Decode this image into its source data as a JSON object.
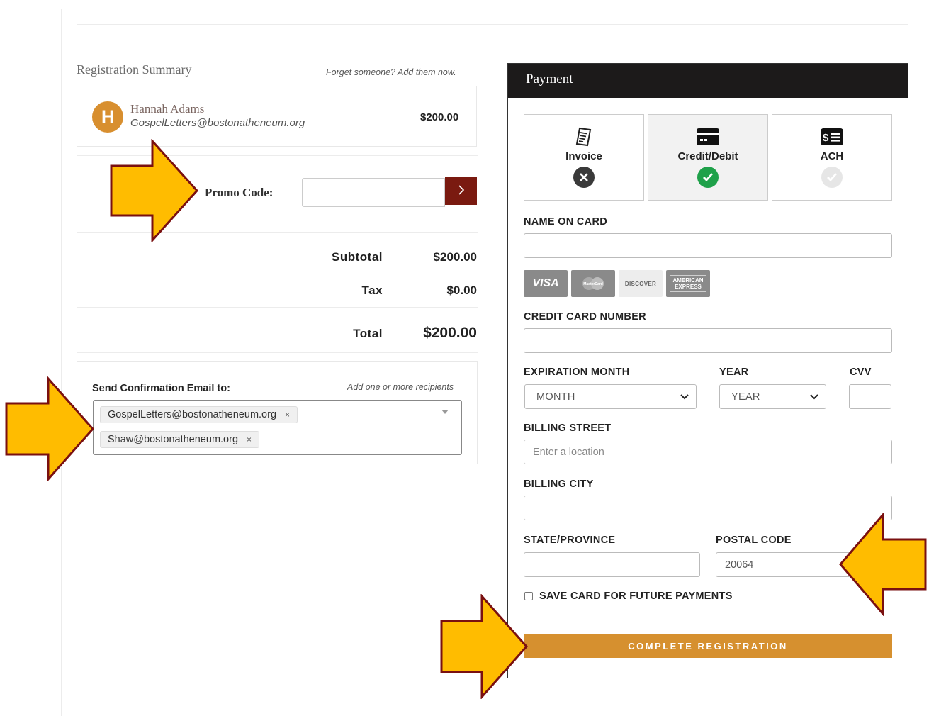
{
  "summary": {
    "title": "Registration Summary",
    "forget_link": "Forget someone? Add them now.",
    "attendee": {
      "initial": "H",
      "name": "Hannah Adams",
      "email": "GospelLetters@bostonatheneum.org",
      "price": "$200.00"
    },
    "promo": {
      "label": "Promo Code:",
      "value": "",
      "submit_icon": "chevron-right-icon"
    },
    "subtotal_label": "Subtotal",
    "subtotal_value": "$200.00",
    "tax_label": "Tax",
    "tax_value": "$0.00",
    "total_label": "Total",
    "total_value": "$200.00"
  },
  "confirmation": {
    "label": "Send Confirmation Email to:",
    "hint": "Add one or more recipients",
    "recipients": [
      "GospelLetters@bostonatheneum.org",
      "Shaw@bostonatheneum.org"
    ],
    "remove_glyph": "×"
  },
  "payment": {
    "title": "Payment",
    "methods": [
      {
        "label": "Invoice",
        "icon": "receipt-icon",
        "state": "unavailable"
      },
      {
        "label": "Credit/Debit",
        "icon": "credit-card-icon",
        "state": "selected"
      },
      {
        "label": "ACH",
        "icon": "bank-transfer-icon",
        "state": "available"
      }
    ],
    "name_label": "NAME ON CARD",
    "name_value": "",
    "cards": [
      "VISA",
      "MasterCard",
      "DISCOVER",
      "AMERICAN EXPRESS"
    ],
    "card_number_label": "CREDIT CARD NUMBER",
    "card_number_value": "",
    "exp_month_label": "EXPIRATION MONTH",
    "exp_month_value": "MONTH",
    "year_label": "YEAR",
    "year_value": "YEAR",
    "cvv_label": "CVV",
    "cvv_value": "",
    "street_label": "BILLING STREET",
    "street_placeholder": "Enter a location",
    "city_label": "BILLING CITY",
    "city_value": "",
    "state_label": "STATE/PROVINCE",
    "state_value": "",
    "postal_label": "POSTAL CODE",
    "postal_value": "20064",
    "save_card_label": "SAVE CARD FOR FUTURE PAYMENTS",
    "save_card_checked": false,
    "submit_label": "COMPLETE REGISTRATION"
  },
  "colors": {
    "accent": "#d6902f",
    "promo_button": "#7a1a10",
    "header": "#1c1a1a",
    "arrow_fill": "#ffbc00",
    "arrow_outline": "#7a1010",
    "success": "#1fa14a"
  }
}
